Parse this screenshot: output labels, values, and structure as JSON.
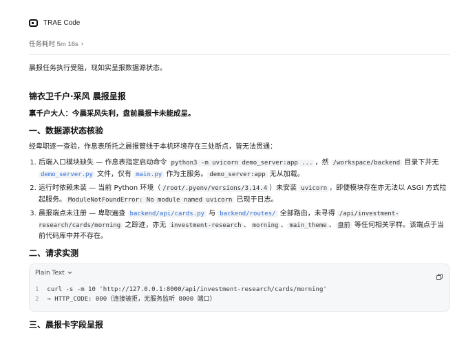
{
  "app": {
    "name": "TRAE Code",
    "icon": "terminal-logo-icon"
  },
  "task": {
    "duration_label": "任务耗时 5m 16s",
    "chevron": "›"
  },
  "intro": "晨报任务执行受阻，现如实呈报数据源状态。",
  "report": {
    "title": "锦衣卫千户·采风 晨报呈报",
    "greeting": "禀千户大人：今晨采风失利，盘前晨报卡未能成呈。",
    "section1": {
      "heading": "一、数据源状态核验",
      "lead": "经卑职逐一查验，作息表所托之晨报管线于本机环境存在三处断点，皆无法贯通：",
      "items": [
        {
          "t1": "后端入口模块缺失 — 作息表指定启动命令 ",
          "c1": "python3 -m uvicorn demo_server:app ...",
          "t2": "，然 ",
          "c2": "/workspace/backend",
          "t3": " 目录下并无 ",
          "c3": "demo_server.py",
          "t4": " 文件，仅有 ",
          "c4": "main.py",
          "t5": " 作为主服务。",
          "c5": "demo_server:app",
          "t6": " 无从加载。"
        },
        {
          "t1": "运行时依赖未装 — 当前 Python 环境（",
          "c1": "/root/.pyenv/versions/3.14.4",
          "t2": "）未安装 ",
          "c2": "uvicorn",
          "t3": "，即便模块存在亦无法以 ASGI 方式拉起服务。",
          "c3": "ModuleNotFoundError: No module named uvicorn",
          "t4": " 已现于日志。"
        },
        {
          "t1": "晨报端点未注册 — 卑职遍查 ",
          "c1": "backend/api/cards.py",
          "t2": " 与 ",
          "c2": "backend/routes/",
          "t3": " 全部路由，未寻得 ",
          "c3": "/api/investment-research/cards/morning",
          "t4": " 之踪迹，亦无 ",
          "c4": "investment-research",
          "t5": "、",
          "c5": "morning",
          "t6": "、",
          "c6": "main_theme",
          "t7": "、",
          "c7": "盘前",
          "t8": " 等任何相关字样。该端点于当前代码库中并不存在。"
        }
      ]
    },
    "section2": {
      "heading": "二、请求实测",
      "code_lang": "Plain Text",
      "code_lines": [
        {
          "n": "1",
          "text": "curl -s -m 10 'http://127.0.0.1:8000/api/investment-research/cards/morning'"
        },
        {
          "n": "2",
          "text": "→ HTTP_CODE: 000（连接被拒，无服务监听 8000 端口）"
        }
      ]
    },
    "section3": {
      "heading": "三、晨报卡字段呈报"
    }
  }
}
